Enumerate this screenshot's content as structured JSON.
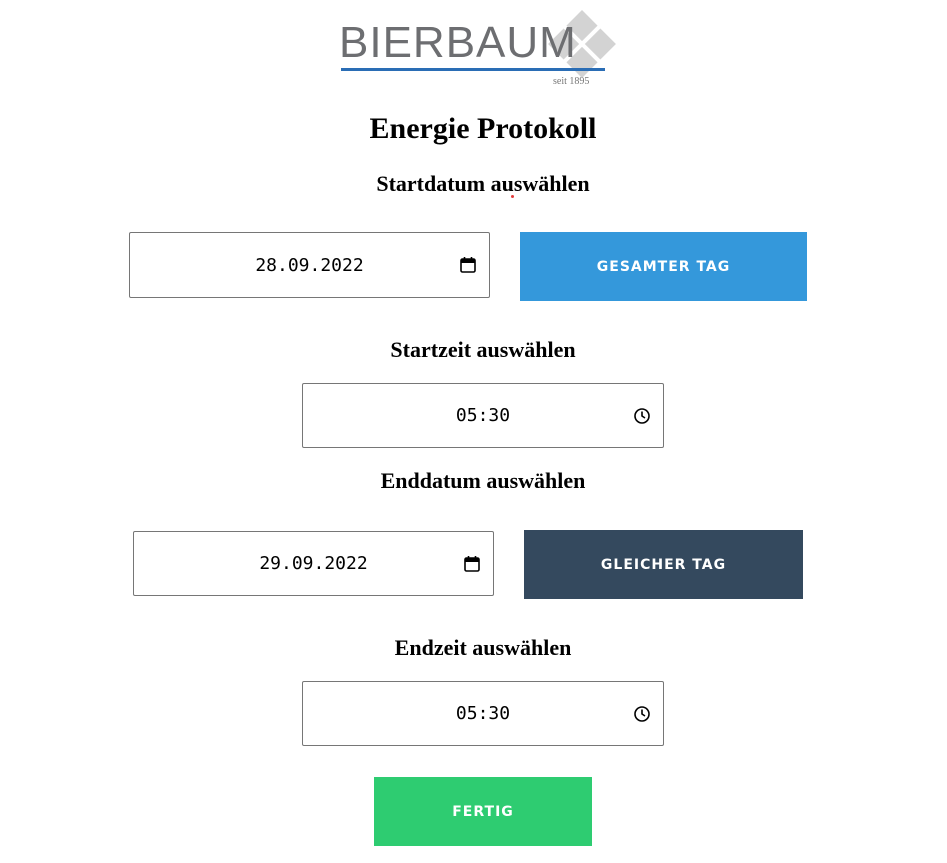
{
  "logo": {
    "brand": "BIERBAUM",
    "tagline": "seit 1895",
    "accent_color": "#2a6db5",
    "diamond_color": "#d0d0d0"
  },
  "page": {
    "title": "Energie Protokoll"
  },
  "start_date": {
    "label": "Startdatum auswählen",
    "value": "28.09.2022",
    "icon": "calendar-icon"
  },
  "whole_day_button": {
    "label": "GESAMTER TAG",
    "color": "#3498db"
  },
  "start_time": {
    "label": "Startzeit auswählen",
    "value": "05:30",
    "icon": "clock-icon"
  },
  "end_date": {
    "label": "Enddatum auswählen",
    "value": "29.09.2022",
    "icon": "calendar-icon"
  },
  "same_day_button": {
    "label": "GLEICHER TAG",
    "color": "#34495e"
  },
  "end_time": {
    "label": "Endzeit auswählen",
    "value": "05:30",
    "icon": "clock-icon"
  },
  "done_button": {
    "label": "FERTIG",
    "color": "#2ecc71"
  }
}
